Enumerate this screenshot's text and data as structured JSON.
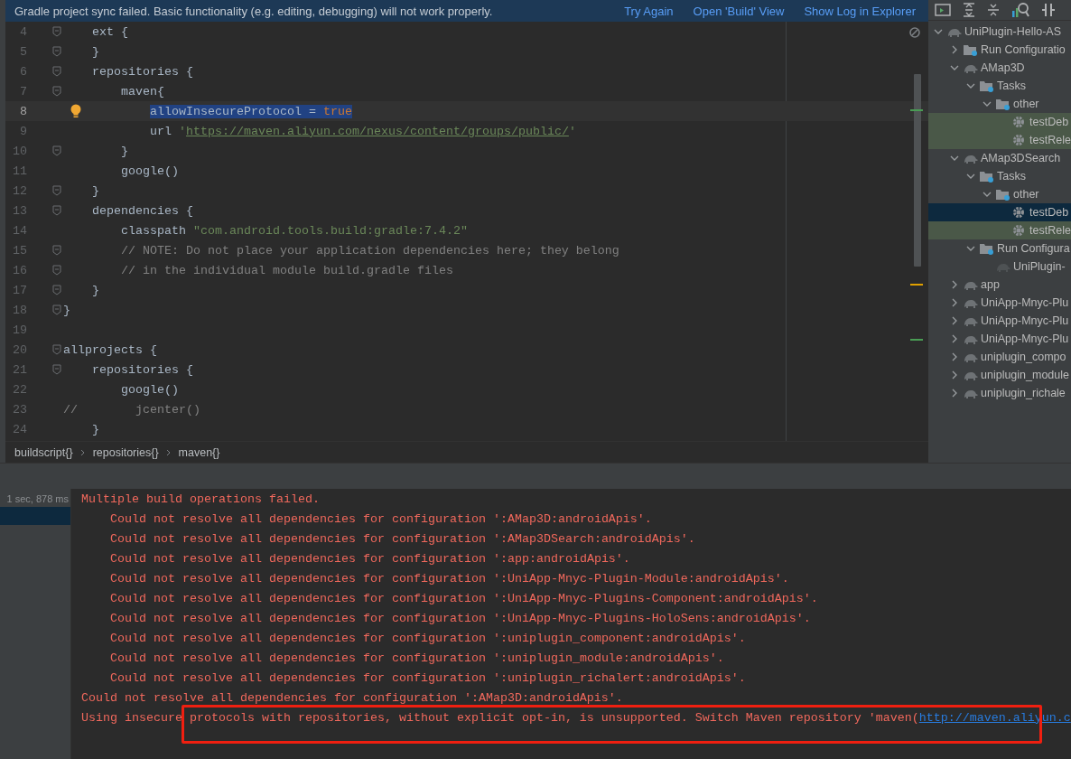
{
  "banner": {
    "message": "Gradle project sync failed. Basic functionality (e.g. editing, debugging) will not work properly.",
    "actions": [
      "Try Again",
      "Open 'Build' View",
      "Show Log in Explorer"
    ]
  },
  "editor": {
    "lines": [
      {
        "number": "4",
        "fold": true,
        "bulb": false,
        "tokens": [
          {
            "kind": "plain",
            "text": "    ext {",
            "selected": false
          }
        ]
      },
      {
        "number": "5",
        "fold": true,
        "bulb": false,
        "tokens": [
          {
            "kind": "plain",
            "text": "    }",
            "selected": false
          }
        ]
      },
      {
        "number": "6",
        "fold": true,
        "bulb": false,
        "tokens": [
          {
            "kind": "plain",
            "text": "    repositories {",
            "selected": false
          }
        ]
      },
      {
        "number": "7",
        "fold": true,
        "bulb": false,
        "tokens": [
          {
            "kind": "plain",
            "text": "        maven{",
            "selected": false
          }
        ]
      },
      {
        "number": "8",
        "fold": false,
        "bulb": true,
        "tokens": [
          {
            "kind": "plain",
            "text": "            allowInsecureProtocol = ",
            "selected": true
          },
          {
            "kind": "keyword",
            "text": "true",
            "selected": true
          }
        ]
      },
      {
        "number": "9",
        "fold": false,
        "bulb": false,
        "tokens": [
          {
            "kind": "plain",
            "text": "            url ",
            "selected": false
          },
          {
            "kind": "string",
            "text": "'",
            "selected": false
          },
          {
            "kind": "url",
            "text": "https://maven.aliyun.com/nexus/content/groups/public/",
            "selected": false
          },
          {
            "kind": "string",
            "text": "'",
            "selected": false
          }
        ]
      },
      {
        "number": "10",
        "fold": true,
        "bulb": false,
        "tokens": [
          {
            "kind": "plain",
            "text": "        }",
            "selected": false
          }
        ]
      },
      {
        "number": "11",
        "fold": false,
        "bulb": false,
        "tokens": [
          {
            "kind": "plain",
            "text": "        google()",
            "selected": false
          }
        ]
      },
      {
        "number": "12",
        "fold": true,
        "bulb": false,
        "tokens": [
          {
            "kind": "plain",
            "text": "    }",
            "selected": false
          }
        ]
      },
      {
        "number": "13",
        "fold": true,
        "bulb": false,
        "tokens": [
          {
            "kind": "plain",
            "text": "    dependencies {",
            "selected": false
          }
        ]
      },
      {
        "number": "14",
        "fold": false,
        "bulb": false,
        "tokens": [
          {
            "kind": "plain",
            "text": "        classpath ",
            "selected": false
          },
          {
            "kind": "string",
            "text": "\"com.android.tools.build:gradle:7.4.2\"",
            "selected": false
          }
        ]
      },
      {
        "number": "15",
        "fold": true,
        "bulb": false,
        "tokens": [
          {
            "kind": "comment",
            "text": "        // NOTE: Do not place your application dependencies here; they belong",
            "selected": false
          }
        ]
      },
      {
        "number": "16",
        "fold": true,
        "bulb": false,
        "tokens": [
          {
            "kind": "comment",
            "text": "        // in the individual module build.gradle files",
            "selected": false
          }
        ]
      },
      {
        "number": "17",
        "fold": true,
        "bulb": false,
        "tokens": [
          {
            "kind": "plain",
            "text": "    }",
            "selected": false
          }
        ]
      },
      {
        "number": "18",
        "fold": true,
        "bulb": false,
        "tokens": [
          {
            "kind": "plain",
            "text": "}",
            "selected": false
          }
        ]
      },
      {
        "number": "19",
        "fold": false,
        "bulb": false
      },
      {
        "number": "20",
        "fold": true,
        "bulb": false,
        "tokens": [
          {
            "kind": "plain",
            "text": "allprojects {",
            "selected": false
          }
        ]
      },
      {
        "number": "21",
        "fold": true,
        "bulb": false,
        "tokens": [
          {
            "kind": "plain",
            "text": "    repositories {",
            "selected": false
          }
        ]
      },
      {
        "number": "22",
        "fold": false,
        "bulb": false,
        "tokens": [
          {
            "kind": "plain",
            "text": "        google()",
            "selected": false
          }
        ]
      },
      {
        "number": "23",
        "fold": false,
        "bulb": false,
        "tokens": [
          {
            "kind": "comment",
            "text": "//        jcenter()",
            "selected": false
          }
        ]
      },
      {
        "number": "24",
        "fold": false,
        "bulb": false,
        "tokens": [
          {
            "kind": "plain",
            "text": "    }",
            "selected": false
          }
        ]
      }
    ]
  },
  "breadcrumb": [
    "buildscript{}",
    "repositories{}",
    "maven{}"
  ],
  "gradle_tree": [
    {
      "label": "UniPlugin-Hello-AS",
      "kind": "module",
      "expanded": true,
      "selected": false,
      "highlighted": false,
      "children": [
        {
          "label": "Run Configuratio",
          "kind": "folder",
          "expanded": false,
          "selected": false,
          "highlighted": false
        },
        {
          "label": "AMap3D",
          "kind": "module",
          "expanded": true,
          "selected": false,
          "highlighted": false,
          "children": [
            {
              "label": "Tasks",
              "kind": "folder",
              "expanded": true,
              "selected": false,
              "highlighted": false,
              "children": [
                {
                  "label": "other",
                  "kind": "folder",
                  "expanded": true,
                  "selected": false,
                  "highlighted": false,
                  "children": [
                    {
                      "label": "testDeb",
                      "kind": "task",
                      "expanded": false,
                      "selected": false,
                      "highlighted": true
                    },
                    {
                      "label": "testRele",
                      "kind": "task",
                      "expanded": false,
                      "selected": false,
                      "highlighted": true
                    }
                  ]
                }
              ]
            }
          ]
        },
        {
          "label": "AMap3DSearch",
          "kind": "module",
          "expanded": true,
          "selected": false,
          "highlighted": false,
          "children": [
            {
              "label": "Tasks",
              "kind": "folder",
              "expanded": true,
              "selected": false,
              "highlighted": false,
              "children": [
                {
                  "label": "other",
                  "kind": "folder",
                  "expanded": true,
                  "selected": false,
                  "highlighted": false,
                  "children": [
                    {
                      "label": "testDeb",
                      "kind": "task",
                      "expanded": false,
                      "selected": true,
                      "highlighted": false
                    },
                    {
                      "label": "testRele",
                      "kind": "task",
                      "expanded": false,
                      "selected": false,
                      "highlighted": true
                    }
                  ]
                }
              ]
            },
            {
              "label": "Run Configura",
              "kind": "folder",
              "expanded": true,
              "selected": false,
              "highlighted": false,
              "children": [
                {
                  "label": "UniPlugin-",
                  "kind": "config",
                  "expanded": false,
                  "selected": false,
                  "highlighted": false
                }
              ]
            }
          ]
        },
        {
          "label": "app",
          "kind": "module",
          "expanded": false,
          "selected": false,
          "highlighted": false
        },
        {
          "label": "UniApp-Mnyc-Plu",
          "kind": "module",
          "expanded": false,
          "selected": false,
          "highlighted": false
        },
        {
          "label": "UniApp-Mnyc-Plu",
          "kind": "module",
          "expanded": false,
          "selected": false,
          "highlighted": false
        },
        {
          "label": "UniApp-Mnyc-Plu",
          "kind": "module",
          "expanded": false,
          "selected": false,
          "highlighted": false
        },
        {
          "label": "uniplugin_compo",
          "kind": "module",
          "expanded": false,
          "selected": false,
          "highlighted": false
        },
        {
          "label": "uniplugin_module",
          "kind": "module",
          "expanded": false,
          "selected": false,
          "highlighted": false
        },
        {
          "label": "uniplugin_richale",
          "kind": "module",
          "expanded": false,
          "selected": false,
          "highlighted": false
        }
      ]
    }
  ],
  "build": {
    "rows": [
      {
        "time": "1 sec, 878 ms",
        "selected": false
      },
      {
        "time": "",
        "selected": true
      }
    ],
    "console": [
      {
        "text": "Multiple build operations failed.",
        "children": [
          {
            "text": "Could not resolve all dependencies for configuration ':AMap3D:androidApis'."
          },
          {
            "text": "Could not resolve all dependencies for configuration ':AMap3DSearch:androidApis'."
          },
          {
            "text": "Could not resolve all dependencies for configuration ':app:androidApis'."
          },
          {
            "text": "Could not resolve all dependencies for configuration ':UniApp-Mnyc-Plugin-Module:androidApis'."
          },
          {
            "text": "Could not resolve all dependencies for configuration ':UniApp-Mnyc-Plugins-Component:androidApis'."
          },
          {
            "text": "Could not resolve all dependencies for configuration ':UniApp-Mnyc-Plugins-HoloSens:androidApis'."
          },
          {
            "text": "Could not resolve all dependencies for configuration ':uniplugin_component:androidApis'."
          },
          {
            "text": "Could not resolve all dependencies for configuration ':uniplugin_module:androidApis'."
          },
          {
            "text": "Could not resolve all dependencies for configuration ':uniplugin_richalert:androidApis'."
          }
        ]
      },
      {
        "text": "Could not resolve all dependencies for configuration ':AMap3D:androidApis'."
      },
      {
        "text": "Using insecure protocols with repositories, without explicit opt-in, is unsupported. Switch Maven repository 'maven(",
        "link": "http://maven.aliyun.c"
      }
    ]
  }
}
